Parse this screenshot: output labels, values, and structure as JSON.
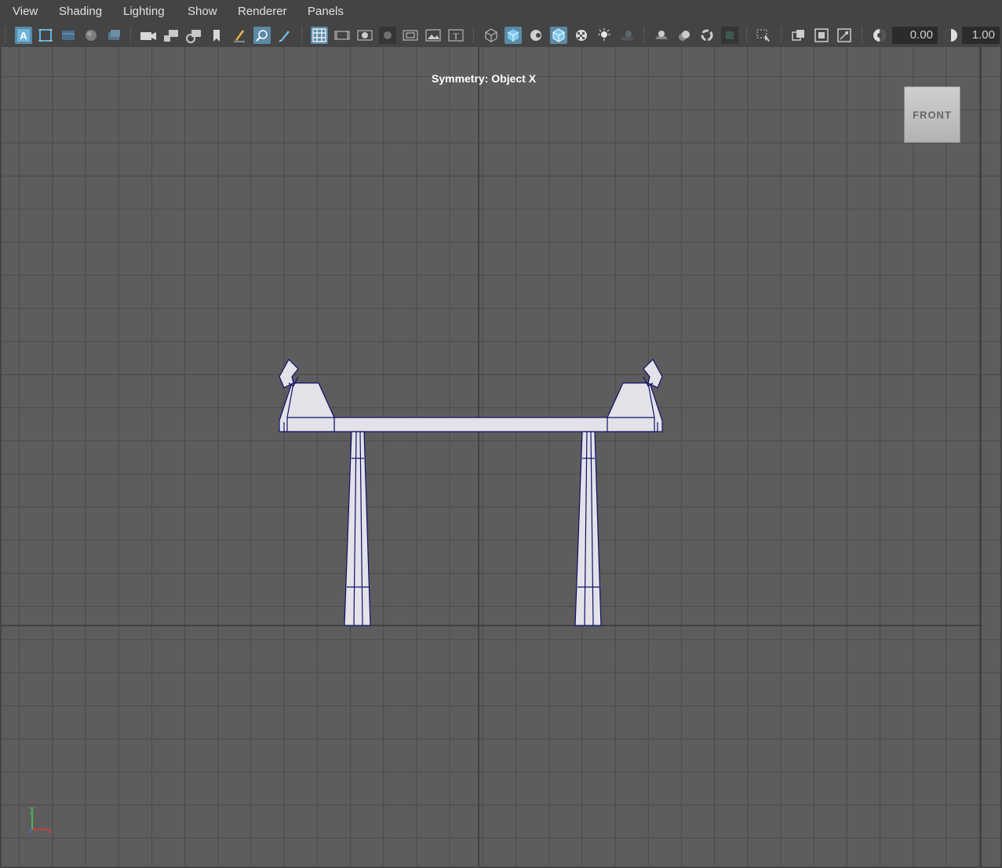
{
  "menu": [
    "View",
    "Shading",
    "Lighting",
    "Show",
    "Renderer",
    "Panels"
  ],
  "toolbar": {
    "icons": [
      "select-camera-icon",
      "camera-attributes-icon",
      "bookmarks-icon",
      "image-plane-icon",
      "camera-icon",
      "lock-camera-icon",
      "camera-settings-icon",
      "bookmark-icon",
      "grease-pencil-icon",
      "isolate-select-icon",
      "paint-icon",
      "grid-icon",
      "film-gate-icon",
      "resolution-gate-icon",
      "gate-mask-icon",
      "field-chart-icon",
      "safe-action-icon",
      "safe-title-icon",
      "wireframe-icon",
      "smooth-shade-icon",
      "use-default-material-icon",
      "wireframe-on-shaded-icon",
      "textured-icon",
      "use-all-lights-icon",
      "shadows-icon",
      "screen-space-ao-icon",
      "motion-blur-icon",
      "multisample-aa-icon",
      "depth-of-field-icon",
      "isolate-icon",
      "xray-icon",
      "xray-active-components-icon",
      "xray-joints-icon",
      "exposure-icon",
      "gamma-icon"
    ],
    "exposure_value": "0.00",
    "gamma_value": "1.00"
  },
  "viewport": {
    "symmetry_label": "Symmetry: Object X",
    "viewcube_label": "FRONT",
    "axis_y_label": "y",
    "axis_x_label": "x",
    "axis_z_label": "z"
  },
  "colors": {
    "viewport_bg": "#5d5d5d",
    "grid_line": "#4a4a4a",
    "mesh_fill": "#e2e2e8",
    "mesh_wire": "#10106a",
    "active_icon": "#5b8aa6"
  }
}
